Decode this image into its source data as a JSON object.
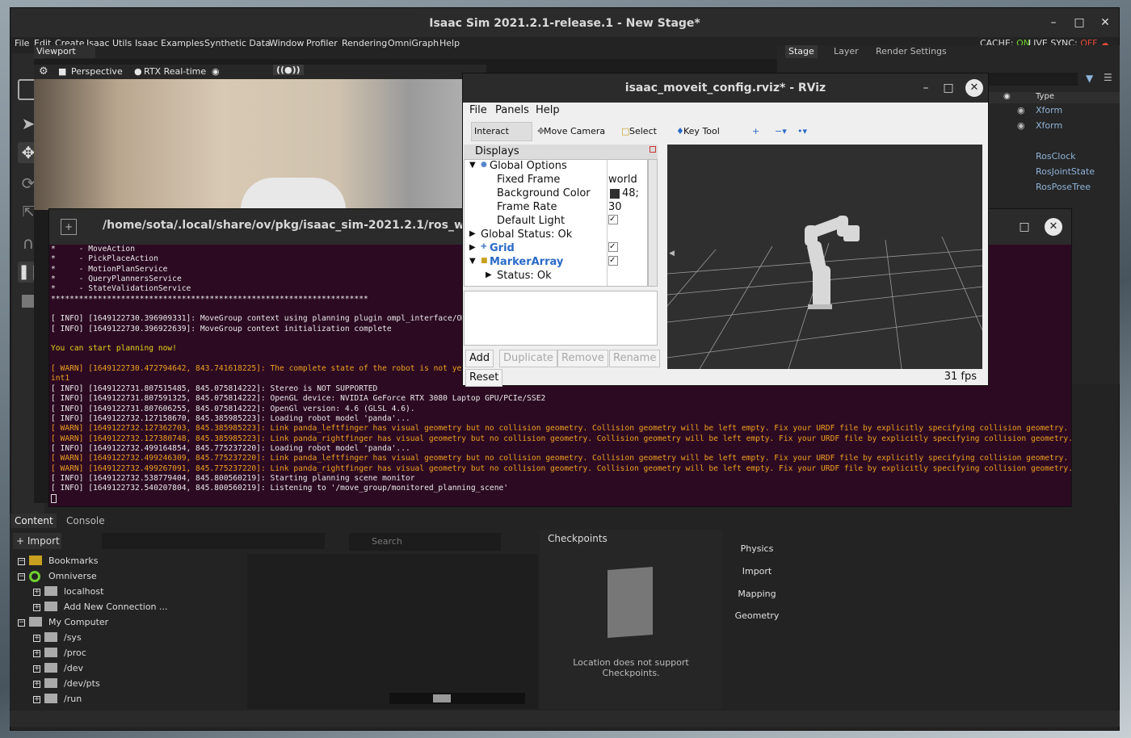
{
  "isaac": {
    "title": "Isaac Sim 2021.2.1-release.1 - New Stage*",
    "menu": [
      "File",
      "Edit",
      "Create",
      "Isaac Utils",
      "Isaac Examples",
      "Synthetic Data",
      "Window",
      "Profiler",
      "Rendering",
      "OmniGraph",
      "Help"
    ],
    "cache_label": "CACHE:",
    "cache_value": "ON",
    "livesync_label": "LIVE SYNC:",
    "livesync_value": "OFF"
  },
  "viewport": {
    "tab": "Viewport",
    "camera": "Perspective",
    "renderer": "RTX Real-time"
  },
  "stage": {
    "tabs": [
      "Stage",
      "Layer",
      "Render Settings"
    ],
    "type_header": "Type",
    "items": [
      "Xform",
      "Xform",
      "RosClock",
      "RosJointState",
      "RosPoseTree"
    ]
  },
  "terminal": {
    "title": "/home/sota/.local/share/ov/pkg/isaac_sim-2021.2.1/ros_workspace",
    "lines": [
      {
        "t": "*     - MoveAction",
        "c": ""
      },
      {
        "t": "*     - PickPlaceAction",
        "c": ""
      },
      {
        "t": "*     - MotionPlanService",
        "c": ""
      },
      {
        "t": "*     - QueryPlannersService",
        "c": ""
      },
      {
        "t": "*     - StateValidationService",
        "c": ""
      },
      {
        "t": "********************************************************************",
        "c": ""
      },
      {
        "t": "",
        "c": ""
      },
      {
        "t": "[ INFO] [1649122730.396909331]: MoveGroup context using planning plugin ompl_interface/OM",
        "c": ""
      },
      {
        "t": "[ INFO] [1649122730.396922639]: MoveGroup context initialization complete",
        "c": ""
      },
      {
        "t": "",
        "c": ""
      },
      {
        "t": "You can start planning now!",
        "c": "yel"
      },
      {
        "t": "",
        "c": ""
      },
      {
        "t": "[ WARN] [1649122730.472794642, 843.741618225]: The complete state of the robot is not yet                                                                                      panda_finger_jo",
        "c": "warn"
      },
      {
        "t": "int1",
        "c": "warn"
      },
      {
        "t": "[ INFO] [1649122731.807515485, 845.075814222]: Stereo is NOT SUPPORTED",
        "c": ""
      },
      {
        "t": "[ INFO] [1649122731.807591325, 845.075814222]: OpenGL device: NVIDIA GeForce RTX 3080 Laptop GPU/PCIe/SSE2",
        "c": ""
      },
      {
        "t": "[ INFO] [1649122731.807606255, 845.075814222]: OpenGl version: 4.6 (GLSL 4.6).",
        "c": ""
      },
      {
        "t": "[ INFO] [1649122732.127158670, 845.385985223]: Loading robot model 'panda'...",
        "c": ""
      },
      {
        "t": "[ WARN] [1649122732.127362703, 845.385985223]: Link panda_leftfinger has visual geometry but no collision geometry. Collision geometry will be left empty. Fix your URDF file by explicitly specifying collision geometry.",
        "c": "warn"
      },
      {
        "t": "[ WARN] [1649122732.127380748, 845.385985223]: Link panda_rightfinger has visual geometry but no collision geometry. Collision geometry will be left empty. Fix your URDF file by explicitly specifying collision geometry.",
        "c": "warn"
      },
      {
        "t": "[ INFO] [1649122732.499164854, 845.775237220]: Loading robot model 'panda'...",
        "c": ""
      },
      {
        "t": "[ WARN] [1649122732.499246309, 845.775237220]: Link panda_leftfinger has visual geometry but no collision geometry. Collision geometry will be left empty. Fix your URDF file by explicitly specifying collision geometry.",
        "c": "warn"
      },
      {
        "t": "[ WARN] [1649122732.499267091, 845.775237220]: Link panda_rightfinger has visual geometry but no collision geometry. Collision geometry will be left empty. Fix your URDF file by explicitly specifying collision geometry.",
        "c": "warn"
      },
      {
        "t": "[ INFO] [1649122732.538779404, 845.800560219]: Starting planning scene monitor",
        "c": ""
      },
      {
        "t": "[ INFO] [1649122732.540207804, 845.800560219]: Listening to '/move_group/monitored_planning_scene'",
        "c": ""
      }
    ]
  },
  "rviz": {
    "title": "isaac_moveit_config.rviz* - RViz",
    "menu": [
      "File",
      "Panels",
      "Help"
    ],
    "tools": [
      "Interact",
      "Move Camera",
      "Select",
      "Key Tool"
    ],
    "displays_title": "Displays",
    "tree": {
      "global_options": "Global Options",
      "fixed_frame": "Fixed Frame",
      "fixed_frame_val": "world",
      "bg_color": "Background Color",
      "bg_color_val": "48;",
      "frame_rate": "Frame Rate",
      "frame_rate_val": "30",
      "default_light": "Default Light",
      "global_status": "Global Status: Ok",
      "grid": "Grid",
      "marker_array": "MarkerArray",
      "status_ok": "Status: Ok"
    },
    "buttons": {
      "add": "Add",
      "duplicate": "Duplicate",
      "remove": "Remove",
      "rename": "Rename",
      "reset": "Reset"
    },
    "fps": "31 fps"
  },
  "content": {
    "tabs": [
      "Content",
      "Console"
    ],
    "import": "Import",
    "search_placeholder": "Search",
    "tree": [
      {
        "label": "Bookmarks",
        "indent": 0
      },
      {
        "label": "Omniverse",
        "indent": 0
      },
      {
        "label": "localhost",
        "indent": 1
      },
      {
        "label": "Add New Connection ...",
        "indent": 1
      },
      {
        "label": "My Computer",
        "indent": 0
      },
      {
        "label": "/sys",
        "indent": 1
      },
      {
        "label": "/proc",
        "indent": 1
      },
      {
        "label": "/dev",
        "indent": 1
      },
      {
        "label": "/dev/pts",
        "indent": 1
      },
      {
        "label": "/run",
        "indent": 1
      }
    ],
    "checkpoints_title": "Checkpoints",
    "checkpoints_msg": "Location does not support Checkpoints."
  },
  "right_tabs": [
    "Physics",
    "Import",
    "Mapping",
    "Geometry"
  ]
}
